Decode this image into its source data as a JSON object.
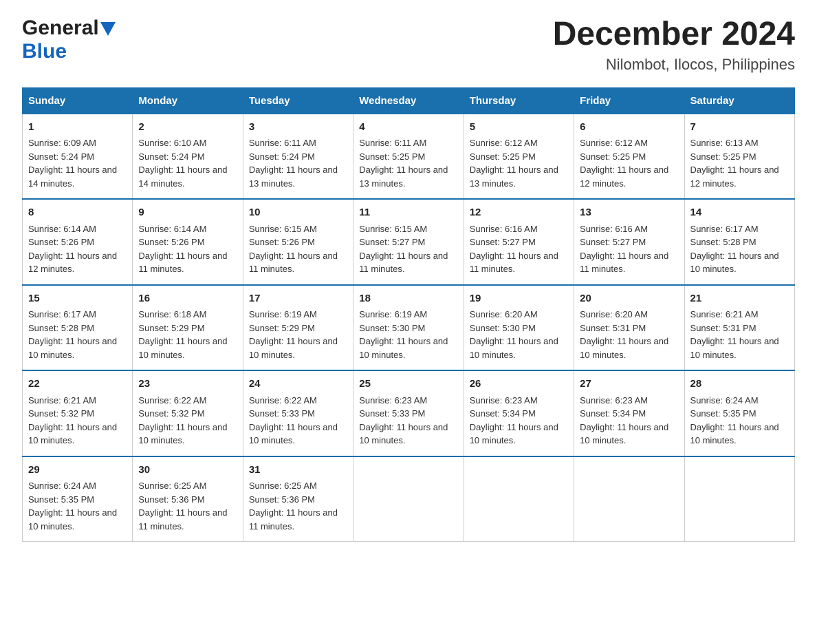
{
  "header": {
    "logo_general": "General",
    "logo_blue": "Blue",
    "title": "December 2024",
    "subtitle": "Nilombot, Ilocos, Philippines"
  },
  "weekdays": [
    "Sunday",
    "Monday",
    "Tuesday",
    "Wednesday",
    "Thursday",
    "Friday",
    "Saturday"
  ],
  "weeks": [
    [
      {
        "day": "1",
        "sunrise": "6:09 AM",
        "sunset": "5:24 PM",
        "daylight": "11 hours and 14 minutes."
      },
      {
        "day": "2",
        "sunrise": "6:10 AM",
        "sunset": "5:24 PM",
        "daylight": "11 hours and 14 minutes."
      },
      {
        "day": "3",
        "sunrise": "6:11 AM",
        "sunset": "5:24 PM",
        "daylight": "11 hours and 13 minutes."
      },
      {
        "day": "4",
        "sunrise": "6:11 AM",
        "sunset": "5:25 PM",
        "daylight": "11 hours and 13 minutes."
      },
      {
        "day": "5",
        "sunrise": "6:12 AM",
        "sunset": "5:25 PM",
        "daylight": "11 hours and 13 minutes."
      },
      {
        "day": "6",
        "sunrise": "6:12 AM",
        "sunset": "5:25 PM",
        "daylight": "11 hours and 12 minutes."
      },
      {
        "day": "7",
        "sunrise": "6:13 AM",
        "sunset": "5:25 PM",
        "daylight": "11 hours and 12 minutes."
      }
    ],
    [
      {
        "day": "8",
        "sunrise": "6:14 AM",
        "sunset": "5:26 PM",
        "daylight": "11 hours and 12 minutes."
      },
      {
        "day": "9",
        "sunrise": "6:14 AM",
        "sunset": "5:26 PM",
        "daylight": "11 hours and 11 minutes."
      },
      {
        "day": "10",
        "sunrise": "6:15 AM",
        "sunset": "5:26 PM",
        "daylight": "11 hours and 11 minutes."
      },
      {
        "day": "11",
        "sunrise": "6:15 AM",
        "sunset": "5:27 PM",
        "daylight": "11 hours and 11 minutes."
      },
      {
        "day": "12",
        "sunrise": "6:16 AM",
        "sunset": "5:27 PM",
        "daylight": "11 hours and 11 minutes."
      },
      {
        "day": "13",
        "sunrise": "6:16 AM",
        "sunset": "5:27 PM",
        "daylight": "11 hours and 11 minutes."
      },
      {
        "day": "14",
        "sunrise": "6:17 AM",
        "sunset": "5:28 PM",
        "daylight": "11 hours and 10 minutes."
      }
    ],
    [
      {
        "day": "15",
        "sunrise": "6:17 AM",
        "sunset": "5:28 PM",
        "daylight": "11 hours and 10 minutes."
      },
      {
        "day": "16",
        "sunrise": "6:18 AM",
        "sunset": "5:29 PM",
        "daylight": "11 hours and 10 minutes."
      },
      {
        "day": "17",
        "sunrise": "6:19 AM",
        "sunset": "5:29 PM",
        "daylight": "11 hours and 10 minutes."
      },
      {
        "day": "18",
        "sunrise": "6:19 AM",
        "sunset": "5:30 PM",
        "daylight": "11 hours and 10 minutes."
      },
      {
        "day": "19",
        "sunrise": "6:20 AM",
        "sunset": "5:30 PM",
        "daylight": "11 hours and 10 minutes."
      },
      {
        "day": "20",
        "sunrise": "6:20 AM",
        "sunset": "5:31 PM",
        "daylight": "11 hours and 10 minutes."
      },
      {
        "day": "21",
        "sunrise": "6:21 AM",
        "sunset": "5:31 PM",
        "daylight": "11 hours and 10 minutes."
      }
    ],
    [
      {
        "day": "22",
        "sunrise": "6:21 AM",
        "sunset": "5:32 PM",
        "daylight": "11 hours and 10 minutes."
      },
      {
        "day": "23",
        "sunrise": "6:22 AM",
        "sunset": "5:32 PM",
        "daylight": "11 hours and 10 minutes."
      },
      {
        "day": "24",
        "sunrise": "6:22 AM",
        "sunset": "5:33 PM",
        "daylight": "11 hours and 10 minutes."
      },
      {
        "day": "25",
        "sunrise": "6:23 AM",
        "sunset": "5:33 PM",
        "daylight": "11 hours and 10 minutes."
      },
      {
        "day": "26",
        "sunrise": "6:23 AM",
        "sunset": "5:34 PM",
        "daylight": "11 hours and 10 minutes."
      },
      {
        "day": "27",
        "sunrise": "6:23 AM",
        "sunset": "5:34 PM",
        "daylight": "11 hours and 10 minutes."
      },
      {
        "day": "28",
        "sunrise": "6:24 AM",
        "sunset": "5:35 PM",
        "daylight": "11 hours and 10 minutes."
      }
    ],
    [
      {
        "day": "29",
        "sunrise": "6:24 AM",
        "sunset": "5:35 PM",
        "daylight": "11 hours and 10 minutes."
      },
      {
        "day": "30",
        "sunrise": "6:25 AM",
        "sunset": "5:36 PM",
        "daylight": "11 hours and 11 minutes."
      },
      {
        "day": "31",
        "sunrise": "6:25 AM",
        "sunset": "5:36 PM",
        "daylight": "11 hours and 11 minutes."
      },
      null,
      null,
      null,
      null
    ]
  ]
}
